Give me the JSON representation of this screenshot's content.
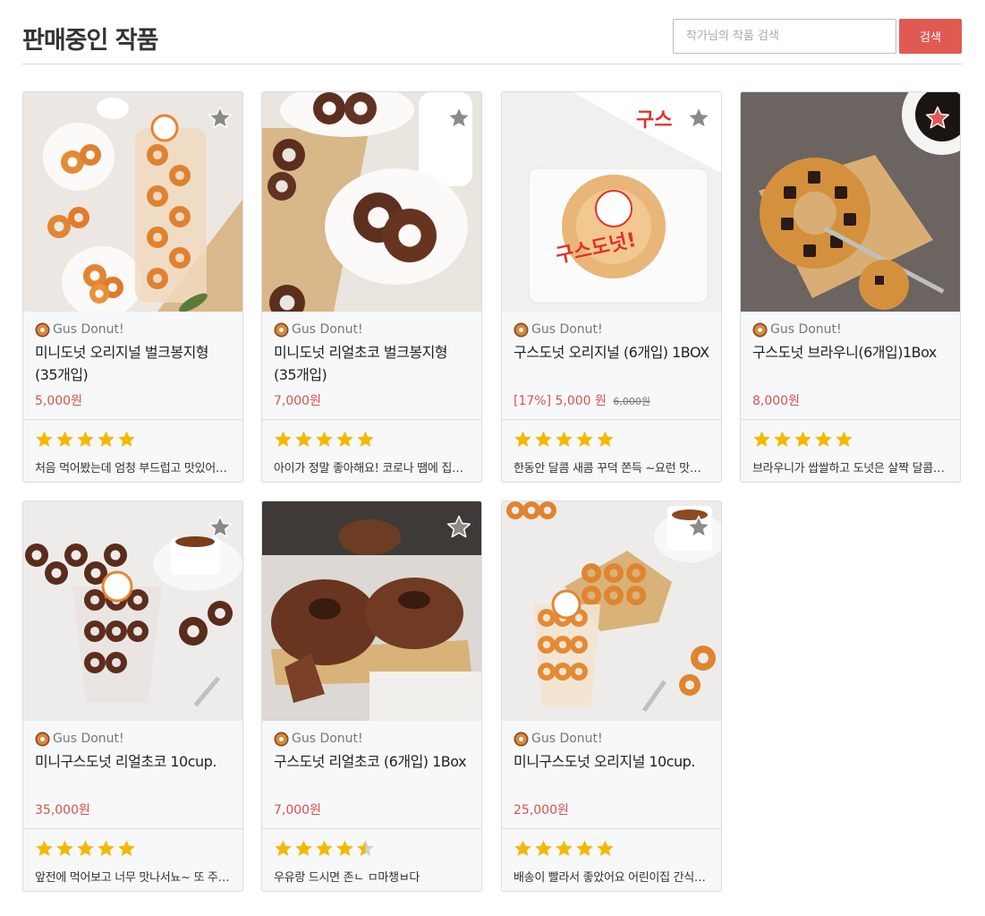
{
  "header": {
    "title": "판매중인 작품",
    "search_placeholder": "작가님의 작품 검색",
    "search_value": "",
    "search_button": "검색"
  },
  "colors": {
    "accent": "#e05a52",
    "price": "#d9534f",
    "star_filled": "#f5b800",
    "star_empty": "#d0d0d0",
    "favorite_active": "#e05a52",
    "favorite_inactive": "#8a8a8a"
  },
  "products": [
    {
      "brand": "Gus Donut!",
      "brand_icon": "donut-icon",
      "name": "미니도넛 오리지널 벌크봉지형 (35개입)",
      "discount": "",
      "price": "5,000원",
      "original_price": "",
      "rating": 5,
      "review": "처음 먹어봤는데 엄청 부드럽고 맛있어요 또 주문할게요",
      "favorited": false,
      "image": "original-mini-donuts-bag"
    },
    {
      "brand": "Gus Donut!",
      "brand_icon": "donut-icon",
      "name": "미니도넛 리얼초코 벌크봉지형 (35개입)",
      "discount": "",
      "price": "7,000원",
      "original_price": "",
      "rating": 5,
      "review": "아이가 정말 좋아해요! 코로나 땜에 집콕 간식으로 최고",
      "favorited": false,
      "image": "choco-mini-donuts-bowl"
    },
    {
      "brand": "Gus Donut!",
      "brand_icon": "donut-icon",
      "name": "구스도넛 오리지널 (6개입) 1BOX",
      "discount": "[17%]",
      "price": "5,000 원",
      "original_price": "6,000원",
      "rating": 5,
      "review": "한동안 달콤 새콤 꾸덕 쫀득 ~요런 맛에 빠져 있었어요",
      "favorited": false,
      "image": "original-donut-pack"
    },
    {
      "brand": "Gus Donut!",
      "brand_icon": "donut-icon",
      "name": "구스도넛 브라우니(6개입)1Box",
      "discount": "",
      "price": "8,000원",
      "original_price": "",
      "rating": 5,
      "review": "브라우니가 쌉쌀하고 도넛은 살짝 달콤해서 좋아요",
      "favorited": true,
      "image": "brownie-donut-board"
    },
    {
      "brand": "Gus Donut!",
      "brand_icon": "donut-icon",
      "name": "미니구스도넛 리얼초코 10cup.",
      "discount": "",
      "price": "35,000원",
      "original_price": "",
      "rating": 5,
      "review": "앞전에 먹어보고 너무 맛나서뇨~ 또 주문했어요",
      "favorited": false,
      "image": "choco-mini-donuts-cup"
    },
    {
      "brand": "Gus Donut!",
      "brand_icon": "donut-icon",
      "name": "구스도넛 리얼초코 (6개입) 1Box",
      "discount": "",
      "price": "7,000원",
      "original_price": "",
      "rating": 4.5,
      "review": "우유랑 드시면 존ㄴ ㅁ마챙ㅂ다",
      "favorited": false,
      "image": "choco-donut-tray"
    },
    {
      "brand": "Gus Donut!",
      "brand_icon": "donut-icon",
      "name": "미니구스도넛 오리지널 10cup.",
      "discount": "",
      "price": "25,000원",
      "original_price": "",
      "rating": 5,
      "review": "배송이 빨라서 좋았어요 어린이집 간식으로 보냈어요",
      "favorited": false,
      "image": "original-mini-donuts-cup"
    }
  ]
}
